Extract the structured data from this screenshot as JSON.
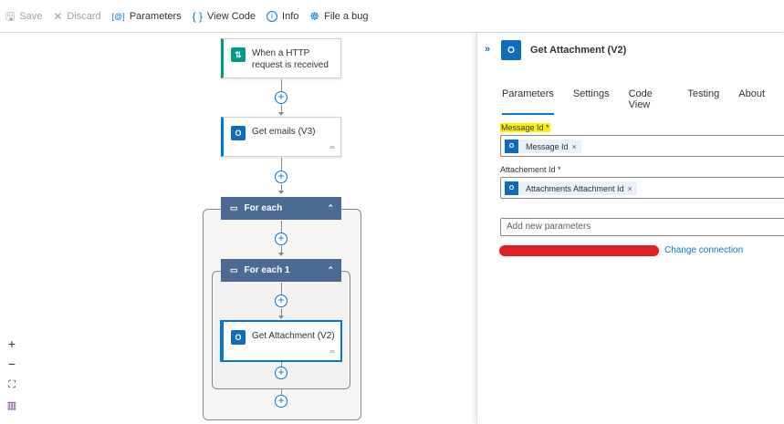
{
  "toolbar": {
    "save": "Save",
    "discard": "Discard",
    "parameters": "Parameters",
    "view_code": "View Code",
    "info": "Info",
    "file_bug": "File a bug"
  },
  "flow": {
    "trigger": "When a HTTP request is received",
    "get_emails": "Get emails (V3)",
    "for_each": "For each",
    "for_each_1": "For each 1",
    "get_attachment": "Get Attachment (V2)"
  },
  "panel": {
    "title": "Get Attachment (V2)",
    "tabs": [
      "Parameters",
      "Settings",
      "Code View",
      "Testing",
      "About"
    ],
    "message_id_label": "Message Id *",
    "message_id_token": "Message Id",
    "attachment_id_label": "Attachement Id *",
    "attachment_id_token": "Attachments Attachment Id",
    "add_params_placeholder": "Add new parameters",
    "change_connection": "Change connection"
  },
  "colors": {
    "accent": "#0078d4",
    "scope_header": "#4b6a94",
    "trigger_icon": "#009a8a",
    "outlook_icon": "#0f6cbd",
    "redaction": "#e02020",
    "highlight": "#fff100"
  }
}
